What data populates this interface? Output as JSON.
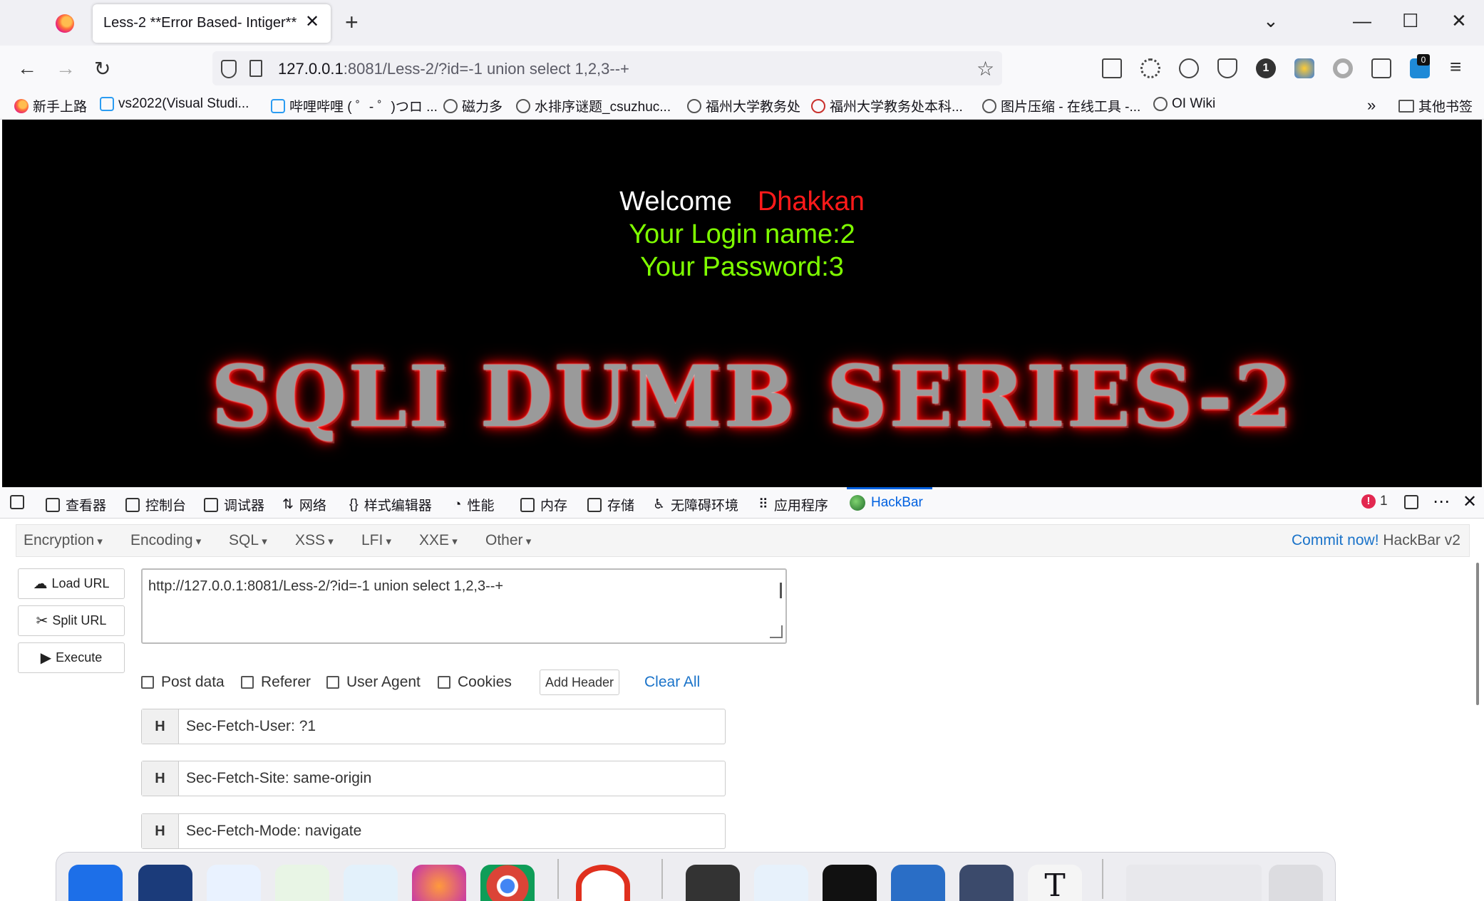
{
  "browser": {
    "tab_title": "Less-2 **Error Based- Intiger**",
    "url_host": "127.0.0.1",
    "url_rest": ":8081/Less-2/?id=-1 union select 1,2,3--+",
    "toolbar_badge_1": "1",
    "toolbar_badge_0": "0",
    "bookmarks": [
      "新手上路",
      "vs2022(Visual Studi...",
      "哔哩哔哩 ( ゜- ゜)つロ ...",
      "磁力多",
      "水排序谜题_csuzhuc...",
      "福州大学教务处",
      "福州大学教务处本科...",
      "图片压缩 - 在线工具 -...",
      "OI Wiki"
    ],
    "other_bookmarks": "其他书签"
  },
  "page": {
    "welcome": "Welcome",
    "user": "Dhakkan",
    "login_name": "Your Login name:2",
    "password": "Your Password:3",
    "banner": "SQLI DUMB SERIES-2"
  },
  "devtools": {
    "tabs": [
      "查看器",
      "控制台",
      "调试器",
      "网络",
      "样式编辑器",
      "性能",
      "内存",
      "存储",
      "无障碍环境",
      "应用程序",
      "HackBar"
    ],
    "error_count": "1"
  },
  "hackbar": {
    "menus": [
      "Encryption",
      "Encoding",
      "SQL",
      "XSS",
      "LFI",
      "XXE",
      "Other"
    ],
    "commit_link": "Commit now!",
    "version": "HackBar v2",
    "load_url": "Load URL",
    "split_url": "Split URL",
    "execute": "Execute",
    "url_value": "http://127.0.0.1:8081/Less-2/?id=-1 union select 1,2,3--+",
    "checkboxes": [
      "Post data",
      "Referer",
      "User Agent",
      "Cookies"
    ],
    "add_header": "Add Header",
    "clear_all": "Clear All",
    "headers": [
      {
        "tag": "H",
        "value": "Sec-Fetch-User: ?1"
      },
      {
        "tag": "H",
        "value": "Sec-Fetch-Site: same-origin"
      },
      {
        "tag": "H",
        "value": "Sec-Fetch-Mode: navigate"
      }
    ]
  },
  "colors": {
    "page_bg": "#000000",
    "welcome": "#ffffff",
    "user": "#ff1a1a",
    "credentials": "#7fff00",
    "hackbar_link": "#1a73c9",
    "devtools_active": "#0061e0"
  }
}
